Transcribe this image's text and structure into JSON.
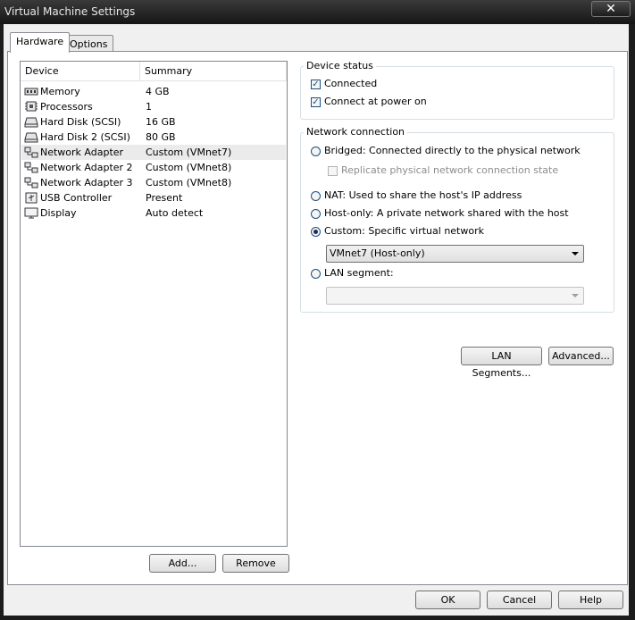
{
  "window": {
    "title": "Virtual Machine Settings",
    "close_glyph": "✕"
  },
  "tabs": [
    {
      "label": "Hardware",
      "active": true
    },
    {
      "label": "Options",
      "active": false
    }
  ],
  "device_list": {
    "columns": {
      "device": "Device",
      "summary": "Summary"
    },
    "rows": [
      {
        "device": "Memory",
        "summary": "4 GB",
        "icon": "memory-icon"
      },
      {
        "device": "Processors",
        "summary": "1",
        "icon": "processor-icon"
      },
      {
        "device": "Hard Disk (SCSI)",
        "summary": "16 GB",
        "icon": "hard-disk-icon"
      },
      {
        "device": "Hard Disk 2 (SCSI)",
        "summary": "80 GB",
        "icon": "hard-disk-icon"
      },
      {
        "device": "Network Adapter",
        "summary": "Custom (VMnet7)",
        "icon": "network-adapter-icon",
        "selected": true
      },
      {
        "device": "Network Adapter 2",
        "summary": "Custom (VMnet8)",
        "icon": "network-adapter-icon"
      },
      {
        "device": "Network Adapter 3",
        "summary": "Custom (VMnet8)",
        "icon": "network-adapter-icon"
      },
      {
        "device": "USB Controller",
        "summary": "Present",
        "icon": "usb-icon"
      },
      {
        "device": "Display",
        "summary": "Auto detect",
        "icon": "display-icon"
      }
    ]
  },
  "list_buttons": {
    "add": "Add...",
    "remove": "Remove"
  },
  "device_status": {
    "title": "Device status",
    "connected": {
      "label": "Connected",
      "checked": true
    },
    "connect_at_power_on": {
      "label": "Connect at power on",
      "checked": true
    }
  },
  "network_connection": {
    "title": "Network connection",
    "bridged": {
      "label": "Bridged: Connected directly to the physical network",
      "selected": false
    },
    "replicate": {
      "label": "Replicate physical network connection state",
      "checked": false,
      "enabled": false
    },
    "nat": {
      "label": "NAT: Used to share the host's IP address",
      "selected": false
    },
    "host_only": {
      "label": "Host-only: A private network shared with the host",
      "selected": false
    },
    "custom": {
      "label": "Custom: Specific virtual network",
      "selected": true
    },
    "custom_network_value": "VMnet7 (Host-only)",
    "lan_segment": {
      "label": "LAN segment:",
      "selected": false
    },
    "lan_segment_value": ""
  },
  "network_buttons": {
    "lan_segments": "LAN Segments...",
    "advanced": "Advanced..."
  },
  "dialog_buttons": {
    "ok": "OK",
    "cancel": "Cancel",
    "help": "Help"
  },
  "colors": {
    "selected_row": "#ebebeb",
    "titlebar": "#1c1c1c",
    "panel": "#ffffff"
  }
}
